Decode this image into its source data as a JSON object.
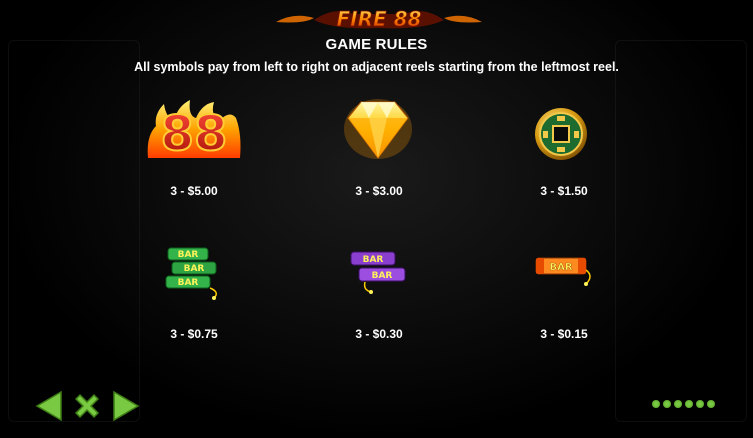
{
  "header": {
    "logo_text": "FIRE 88",
    "title": "GAME RULES",
    "subtitle": "All symbols pay from left to right on adjacent reels starting from the leftmost reel."
  },
  "symbols": [
    {
      "name": "fire-88",
      "icon": "fire-88-icon",
      "payout": "3 - $5.00"
    },
    {
      "name": "diamond",
      "icon": "gold-diamond-icon",
      "payout": "3 - $3.00"
    },
    {
      "name": "coin",
      "icon": "chinese-coin-icon",
      "payout": "3 - $1.50"
    },
    {
      "name": "triple-bar",
      "icon": "green-triple-bar-icon",
      "payout": "3 - $0.75"
    },
    {
      "name": "double-bar",
      "icon": "purple-double-bar-icon",
      "payout": "3 - $0.30"
    },
    {
      "name": "single-bar",
      "icon": "orange-single-bar-icon",
      "payout": "3 - $0.15"
    }
  ],
  "nav": {
    "prev_icon": "left-arrow-icon",
    "close_icon": "close-x-icon",
    "next_icon": "right-arrow-icon",
    "page_count": 6
  },
  "colors": {
    "nav_green": "#7ac943",
    "fire_red": "#e8281a",
    "gold": "#f5b400"
  }
}
